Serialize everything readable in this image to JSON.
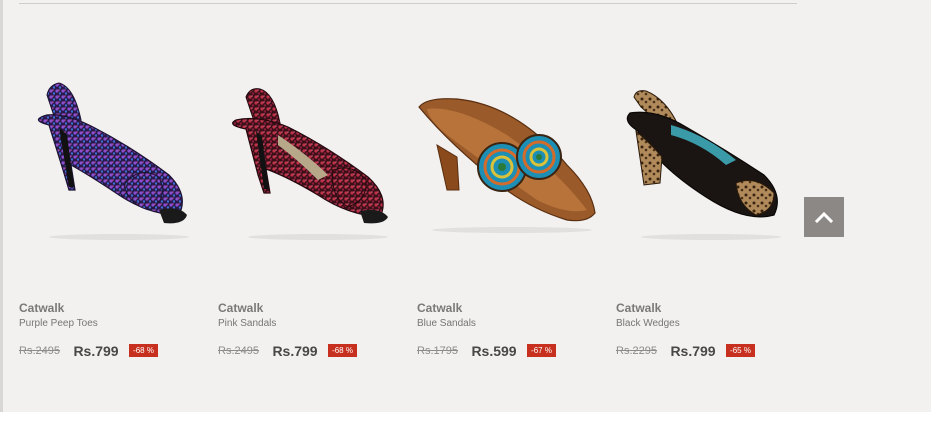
{
  "products": [
    {
      "brand": "Catwalk",
      "name": "Purple Peep Toes",
      "old_price": "Rs.2495",
      "new_price": "Rs.799",
      "discount": "-68 %"
    },
    {
      "brand": "Catwalk",
      "name": "Pink Sandals",
      "old_price": "Rs.2495",
      "new_price": "Rs.799",
      "discount": "-68 %"
    },
    {
      "brand": "Catwalk",
      "name": "Blue Sandals",
      "old_price": "Rs.1795",
      "new_price": "Rs.599",
      "discount": "-67 %"
    },
    {
      "brand": "Catwalk",
      "name": "Black Wedges",
      "old_price": "Rs.2295",
      "new_price": "Rs.799",
      "discount": "-65 %"
    }
  ],
  "scroll_top": {
    "icon": "chevron-up-icon"
  },
  "colors": {
    "discount_badge": "#c7301e",
    "background": "#f2f1f0",
    "scroll_button": "#8b8886"
  }
}
